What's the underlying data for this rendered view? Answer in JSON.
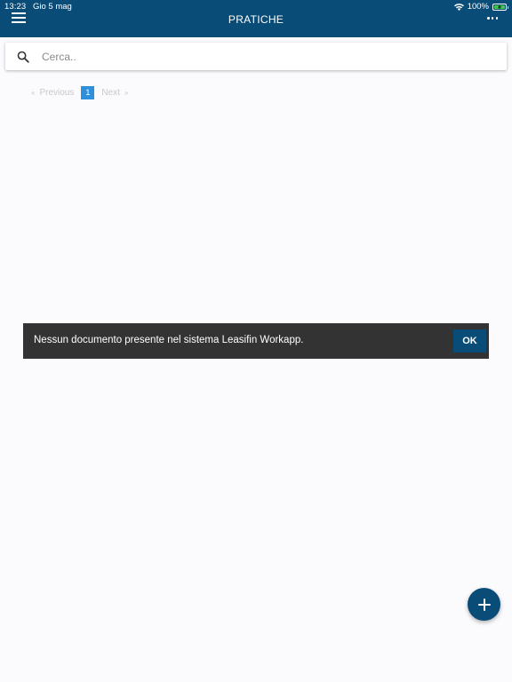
{
  "status_bar": {
    "time": "13:23",
    "date": "Gio 5 mag",
    "battery_percent": "100%",
    "wifi_icon": "wifi-icon",
    "battery_icon": "battery-charging-icon"
  },
  "header": {
    "title": "PRATICHE",
    "menu_icon": "hamburger-menu-icon",
    "more_icon": "more-horizontal-icon",
    "background_color": "#0a4c78"
  },
  "search": {
    "placeholder": "Cerca..",
    "value": "",
    "icon": "search-icon"
  },
  "pagination": {
    "prev_chevron": "«",
    "prev_label": "Previous",
    "current_page": "1",
    "next_label": "Next",
    "next_chevron": "»",
    "active_color": "#2e8fdc"
  },
  "snackbar": {
    "message": "Nessun documento presente nel sistema Leasifin Workapp.",
    "action_label": "OK"
  },
  "fab": {
    "icon": "plus-icon"
  }
}
